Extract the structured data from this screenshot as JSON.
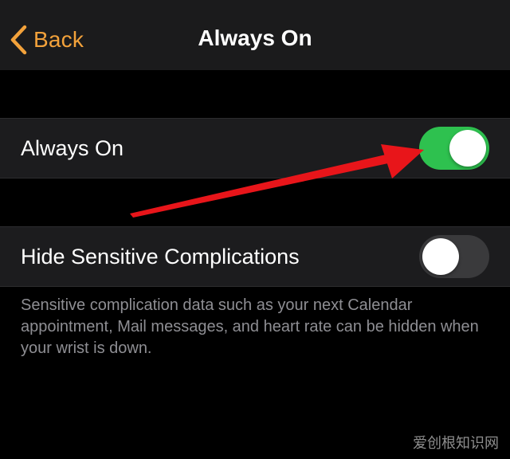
{
  "nav": {
    "back_label": "Back",
    "title": "Always On"
  },
  "settings": [
    {
      "label": "Always On",
      "toggle": "on"
    },
    {
      "label": "Hide Sensitive Complications",
      "toggle": "off"
    }
  ],
  "footnote": "Sensitive complication data such as your next Calendar appointment, Mail messages, and heart rate can be hidden when your wrist is down.",
  "colors": {
    "accent": "#f3a23b",
    "toggle_on": "#2ec14f",
    "toggle_off": "#3a3a3c",
    "arrow": "#e8151a"
  },
  "watermark": "爱创根知识网"
}
